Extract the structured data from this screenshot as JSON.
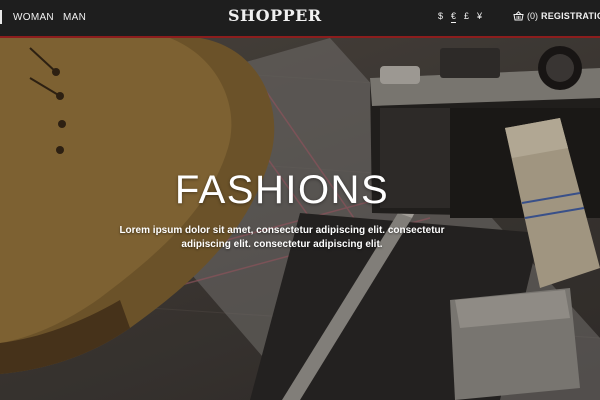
{
  "header": {
    "nav": [
      {
        "label": "WOMAN"
      },
      {
        "label": "MAN"
      }
    ],
    "logo": "SHOPPER",
    "currencies": [
      "$",
      "€",
      "£",
      "¥"
    ],
    "active_currency": "€",
    "cart": {
      "icon": "basket-icon",
      "count": "(0)",
      "label": "REGISTRATION"
    },
    "accent_color": "#8c1d1d"
  },
  "hero": {
    "title": "FASHIONS",
    "text": "Lorem ipsum dolor sit amet, consectetur adipiscing elit. consectetur adipiscing elit. consectetur adipiscing elit."
  }
}
